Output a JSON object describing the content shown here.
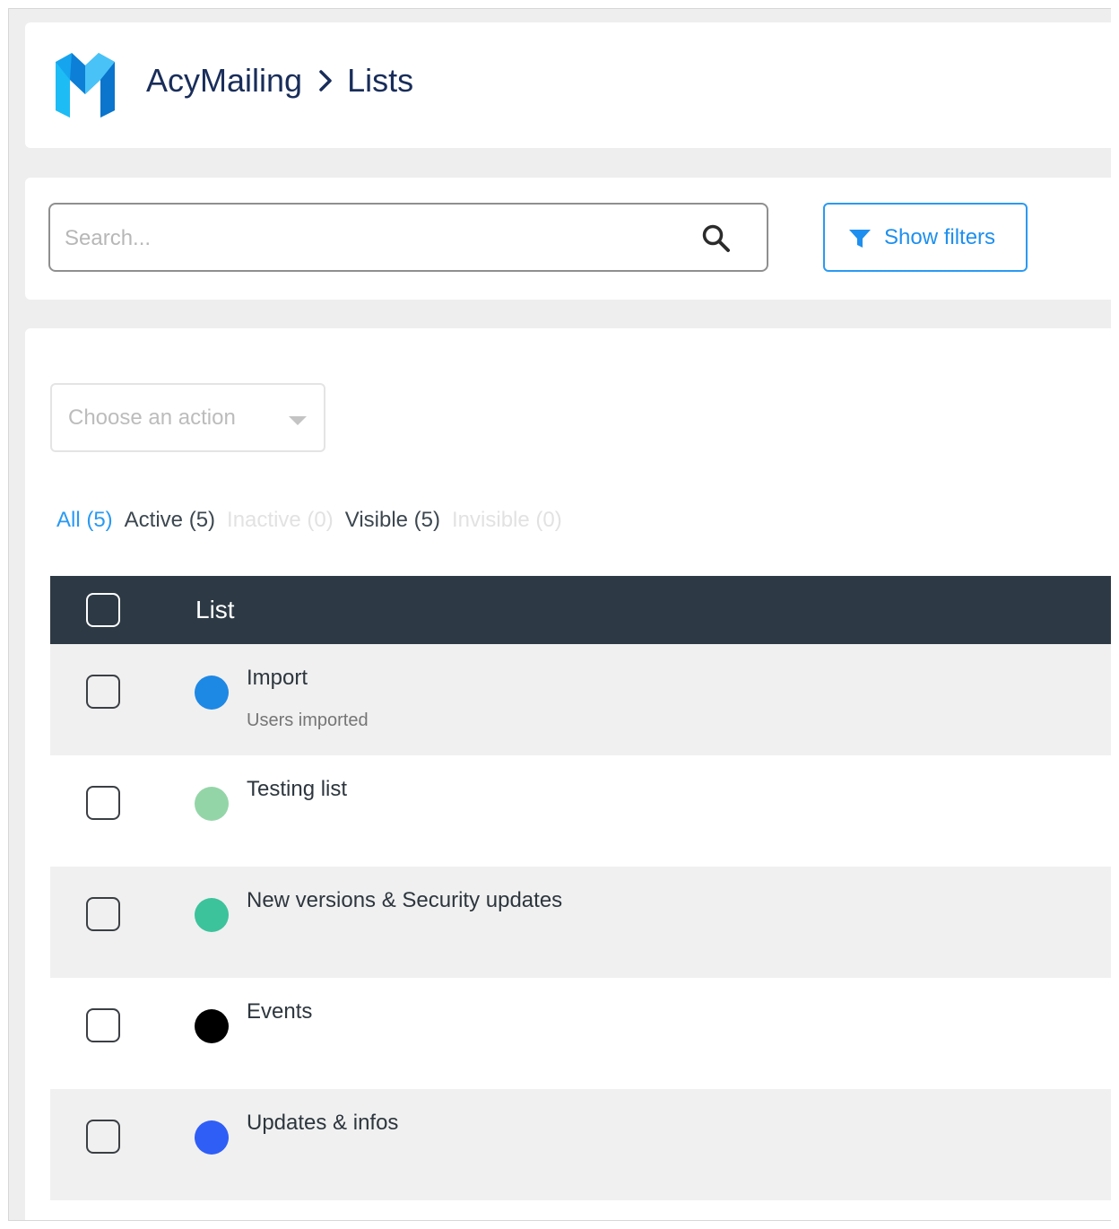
{
  "header": {
    "app_name": "AcyMailing",
    "page": "Lists"
  },
  "search": {
    "placeholder": "Search...",
    "value": ""
  },
  "filters_button": {
    "label": "Show filters"
  },
  "action_select": {
    "label": "Choose an action"
  },
  "status_tabs": [
    {
      "label": "All (5)",
      "state": "current"
    },
    {
      "label": "Active (5)",
      "state": "normal"
    },
    {
      "label": "Inactive (0)",
      "state": "muted"
    },
    {
      "label": "Visible (5)",
      "state": "normal"
    },
    {
      "label": "Invisible (0)",
      "state": "muted"
    }
  ],
  "table": {
    "column_header": "List",
    "rows": [
      {
        "name": "Import",
        "description": "Users imported",
        "color": "#1e88e5"
      },
      {
        "name": "Testing list",
        "description": "",
        "color": "#94d5a8"
      },
      {
        "name": "New versions & Security updates",
        "description": "",
        "color": "#3cc39b"
      },
      {
        "name": "Events",
        "description": "",
        "color": "#000000"
      },
      {
        "name": "Updates & infos",
        "description": "",
        "color": "#2f5ef7"
      }
    ]
  },
  "colors": {
    "brand_navy": "#192d5a",
    "accent_blue": "#2a9af2",
    "table_header": "#2d3a45"
  },
  "icons": {
    "logo": "acymailing-logo-icon",
    "breadcrumb_separator": "chevron-right-icon",
    "search": "search-icon",
    "filter": "filter-funnel-icon",
    "select_caret": "caret-down-icon"
  }
}
